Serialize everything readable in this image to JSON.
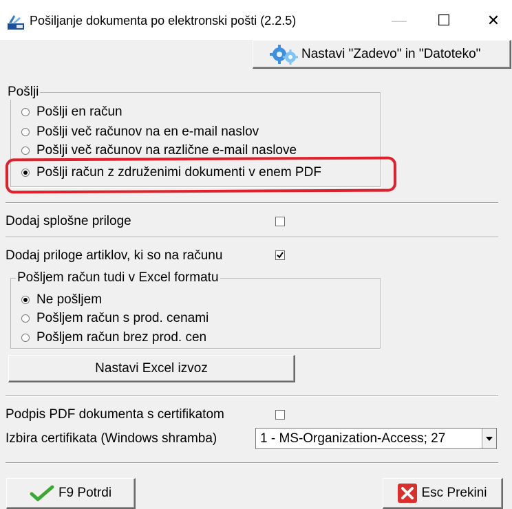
{
  "window": {
    "title": "Pošiljanje dokumenta po elektronski pošti  (2.2.5)",
    "minimize_glyph": "—",
    "maximize_glyph": "☐",
    "close_glyph": "✕"
  },
  "toolbar": {
    "settings_button_label": "Nastavi \"Zadevo\" in \"Datoteko\"",
    "settings_icon": "gears-icon"
  },
  "send_group": {
    "label": "Pošlji",
    "options": [
      {
        "label": "Pošlji en račun",
        "selected": false
      },
      {
        "label": "Pošlji več računov na en e-mail naslov",
        "selected": false
      },
      {
        "label": "Pošlji več računov na različne e-mail naslove",
        "selected": false
      },
      {
        "label": "Pošlji račun z združenimi dokumenti v enem PDF",
        "selected": true
      }
    ]
  },
  "general_attachments": {
    "label": "Dodaj splošne priloge",
    "checked": false
  },
  "item_attachments": {
    "label": "Dodaj priloge artiklov, ki so na računu",
    "checked": true
  },
  "excel_group": {
    "label": "Pošljem račun tudi v Excel formatu",
    "options": [
      {
        "label": "Ne pošljem",
        "selected": true
      },
      {
        "label": "Pošljem račun s prod. cenami",
        "selected": false
      },
      {
        "label": "Pošljem račun brez prod. cen",
        "selected": false
      }
    ]
  },
  "excel_export_button": "Nastavi Excel izvoz",
  "pdf_signature": {
    "label": "Podpis PDF dokumenta s certifikatom",
    "checked": false
  },
  "certificate": {
    "label": "Izbira certifikata (Windows shramba)",
    "value": "1 - MS-Organization-Access;  27"
  },
  "footer": {
    "confirm_label": "F9 Potrdi",
    "cancel_label": "Esc Prekini"
  },
  "colors": {
    "highlight_annotation": "#e0202a",
    "check_green": "#3aa832",
    "cancel_red": "#d9302c"
  }
}
